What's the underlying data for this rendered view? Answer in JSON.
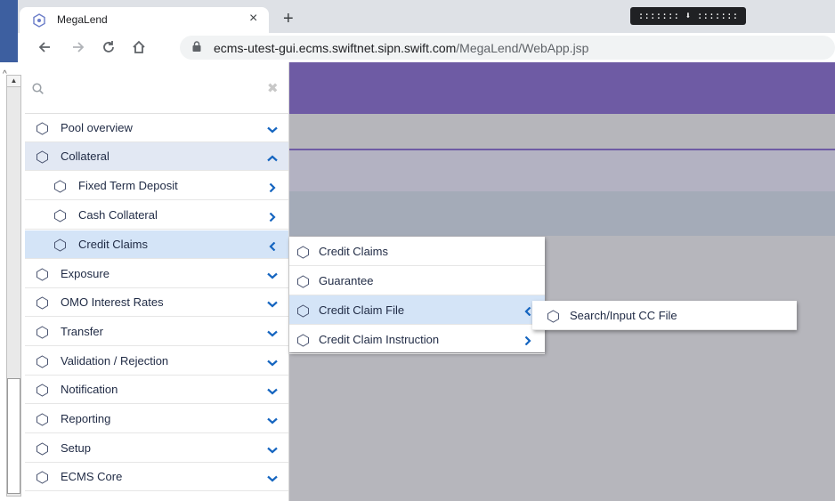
{
  "browser": {
    "tab_title": "MegaLend",
    "new_tab_symbol": "+",
    "close_symbol": "×",
    "extension_label": "::::::: ⬇ :::::::",
    "url_host": "ecms-utest-gui.ecms.swiftnet.sipn.swift.com",
    "url_path": "/MegaLend/WebApp.jsp"
  },
  "search": {
    "placeholder": "",
    "clear_symbol": "✖"
  },
  "menu": {
    "items": [
      {
        "label": "Pool overview"
      },
      {
        "label": "Collateral"
      },
      {
        "label": "Fixed Term Deposit"
      },
      {
        "label": "Cash Collateral"
      },
      {
        "label": "Credit Claims"
      },
      {
        "label": "Exposure"
      },
      {
        "label": "OMO Interest Rates"
      },
      {
        "label": "Transfer"
      },
      {
        "label": "Validation / Rejection"
      },
      {
        "label": "Notification"
      },
      {
        "label": "Reporting"
      },
      {
        "label": "Setup"
      },
      {
        "label": "ECMS Core"
      }
    ]
  },
  "submenu_credit_claims": {
    "items": [
      {
        "label": "Credit Claims"
      },
      {
        "label": "Guarantee"
      },
      {
        "label": "Credit Claim File"
      },
      {
        "label": "Credit Claim Instruction"
      }
    ]
  },
  "submenu_credit_claim_file": {
    "items": [
      {
        "label": "Search/Input CC File"
      }
    ]
  },
  "colors": {
    "header_purple": "#6e5ba4",
    "selected_blue": "#d4e4f7",
    "chevron_blue": "#1565c0"
  }
}
